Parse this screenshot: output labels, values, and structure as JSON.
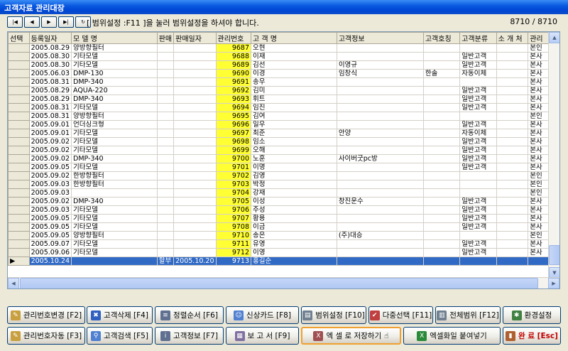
{
  "window": {
    "title": "고객자료 관리대장"
  },
  "hint": "[ 범위설정 :F11 ]을 눌러 범위설정을 하셔야 합니다.",
  "counter": "8710 / 8710",
  "columns": [
    "선택",
    "등록일자",
    "모 델 명",
    "판매",
    "판매일자",
    "관리번호",
    "고 객 명",
    "고객정보",
    "고객호칭",
    "고객분류",
    "소 개 처",
    "관리"
  ],
  "rows": [
    [
      "",
      "2005.08.29",
      "양방향필터",
      "",
      "",
      "9687",
      "오현",
      "",
      "",
      "",
      "",
      "본인"
    ],
    [
      "",
      "2005.08.30",
      "기타모델",
      "",
      "",
      "9688",
      "이재",
      "",
      "",
      "일반고객",
      "",
      "본사"
    ],
    [
      "",
      "2005.08.30",
      "기타모델",
      "",
      "",
      "9689",
      "김선",
      "이영규",
      "",
      "일반고객",
      "",
      "본사"
    ],
    [
      "",
      "2005.06.03",
      "DMP-130",
      "",
      "",
      "9690",
      "이경",
      "임창식",
      "한솔",
      "자동이체",
      "",
      "본사"
    ],
    [
      "",
      "2005.08.31",
      "DMP-340",
      "",
      "",
      "9691",
      "송우",
      "",
      "",
      "",
      "",
      "본사"
    ],
    [
      "",
      "2005.08.29",
      "AQUA-220",
      "",
      "",
      "9692",
      "김미",
      "",
      "",
      "일반고객",
      "",
      "본사"
    ],
    [
      "",
      "2005.08.29",
      "DMP-340",
      "",
      "",
      "9693",
      "휘트",
      "",
      "",
      "일반고객",
      "",
      "본사"
    ],
    [
      "",
      "2005.08.31",
      "기타모델",
      "",
      "",
      "9694",
      "임진",
      "",
      "",
      "일반고객",
      "",
      "본사"
    ],
    [
      "",
      "2005.08.31",
      "양방향필터",
      "",
      "",
      "9695",
      "김여",
      "",
      "",
      "",
      "",
      "본인"
    ],
    [
      "",
      "2005.09.01",
      "언더싱크형",
      "",
      "",
      "9696",
      "일우",
      "",
      "",
      "일반고객",
      "",
      "본사"
    ],
    [
      "",
      "2005.09.01",
      "기타모델",
      "",
      "",
      "9697",
      "최준",
      "안양",
      "",
      "자동이체",
      "",
      "본사"
    ],
    [
      "",
      "2005.09.02",
      "기타모델",
      "",
      "",
      "9698",
      "임소",
      "",
      "",
      "일반고객",
      "",
      "본사"
    ],
    [
      "",
      "2005.09.02",
      "기타모델",
      "",
      "",
      "9699",
      "오해",
      "",
      "",
      "일반고객",
      "",
      "본사"
    ],
    [
      "",
      "2005.09.02",
      "DMP-340",
      "",
      "",
      "9700",
      "노훈",
      "사이버굿pc방",
      "",
      "일반고객",
      "",
      "본사"
    ],
    [
      "",
      "2005.09.05",
      "기타모델",
      "",
      "",
      "9701",
      "이명",
      "",
      "",
      "일반고객",
      "",
      "본사"
    ],
    [
      "",
      "2005.09.02",
      "한방향필터",
      "",
      "",
      "9702",
      "김영",
      "",
      "",
      "",
      "",
      "본인"
    ],
    [
      "",
      "2005.09.03",
      "한방향필터",
      "",
      "",
      "9703",
      "박정",
      "",
      "",
      "",
      "",
      "본인"
    ],
    [
      "",
      "2005.09.03",
      "",
      "",
      "",
      "9704",
      "강재",
      "",
      "",
      "",
      "",
      "본인"
    ],
    [
      "",
      "2005.09.02",
      "DMP-340",
      "",
      "",
      "9705",
      "이성",
      "창진운수",
      "",
      "일반고객",
      "",
      "본사"
    ],
    [
      "",
      "2005.09.03",
      "기타모델",
      "",
      "",
      "9706",
      "주성",
      "",
      "",
      "일반고객",
      "",
      "본사"
    ],
    [
      "",
      "2005.09.05",
      "기타모델",
      "",
      "",
      "9707",
      "황용",
      "",
      "",
      "일반고객",
      "",
      "본사"
    ],
    [
      "",
      "2005.09.05",
      "기타모델",
      "",
      "",
      "9708",
      "이금",
      "",
      "",
      "일반고객",
      "",
      "본사"
    ],
    [
      "",
      "2005.09.05",
      "양방향필터",
      "",
      "",
      "9710",
      "송은",
      "(주)대승",
      "",
      "",
      "",
      "본인"
    ],
    [
      "",
      "2005.09.07",
      "기타모델",
      "",
      "",
      "9711",
      "유영",
      "",
      "",
      "일반고객",
      "",
      "본사"
    ],
    [
      "",
      "2005.09.06",
      "기타모델",
      "",
      "",
      "9712",
      "이영",
      "",
      "",
      "일반고객",
      "",
      "본사"
    ],
    [
      "",
      "2005.10.24",
      "",
      "할부",
      "2005.10.20",
      "9713",
      "홍길순",
      "",
      "",
      "",
      "",
      ""
    ]
  ],
  "buttons": {
    "row1": [
      "관리번호변경 [F2]",
      "고객삭제 [F4]",
      "정렬순서 [F6]",
      "신상카드 [F8]",
      "범위설정 [F10]",
      "다중선택 [F11]",
      "전체범위 [F12]",
      "환경설정"
    ],
    "row2": [
      "관리번호자동 [F3]",
      "고객검색 [F5]",
      "고객정보 [F7]",
      "보 고 서 [F9]",
      "엑 셀 로 저장하기",
      "엑셀화일 붙여넣기",
      "완 료 [Esc]"
    ]
  },
  "colors": {
    "highlight_col": "#ffff33",
    "selection": "#316ac5"
  }
}
